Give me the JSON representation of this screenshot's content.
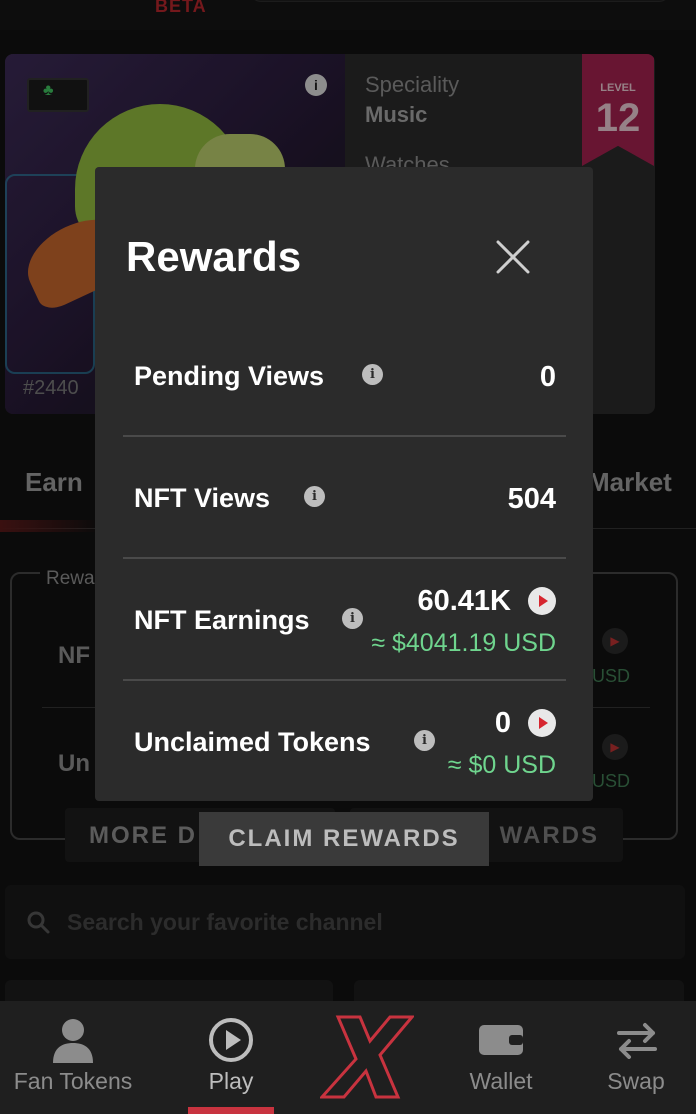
{
  "app": {
    "beta_badge": "BETA"
  },
  "nft_card": {
    "id": "#2440",
    "speciality_label": "Speciality",
    "speciality_value": "Music",
    "watches_label": "Watches",
    "level_label": "LEVEL",
    "level_value": "12"
  },
  "tabs": {
    "earn": "Earn",
    "market": "Market"
  },
  "rewards_box": {
    "legend": "Rewa",
    "row1_partial": "NF",
    "row2_partial": "Un",
    "usd_partial_1": "USD",
    "usd_partial_2": "USD"
  },
  "buttons": {
    "more_details_partial": "MORE D",
    "claim_rewards_bg_partial": "WARDS",
    "claim_rewards": "CLAIM REWARDS"
  },
  "search": {
    "placeholder": "Search your favorite channel"
  },
  "modal": {
    "title": "Rewards",
    "rows": [
      {
        "label": "Pending Views",
        "value": "0"
      },
      {
        "label": "NFT Views",
        "value": "504"
      },
      {
        "label": "NFT Earnings",
        "value": "60.41K",
        "usd": "≈ $4041.19 USD"
      },
      {
        "label": "Unclaimed Tokens",
        "value": "0",
        "usd": "≈ $0 USD"
      }
    ]
  },
  "bottom_nav": {
    "items": [
      {
        "label": "Fan Tokens",
        "icon": "user-icon"
      },
      {
        "label": "Play",
        "icon": "play-icon",
        "active": true
      },
      {
        "label": "",
        "icon": "x-logo-icon"
      },
      {
        "label": "Wallet",
        "icon": "wallet-icon"
      },
      {
        "label": "Swap",
        "icon": "swap-arrows-icon"
      }
    ]
  },
  "colors": {
    "accent_red": "#c8333f",
    "usd_green": "#6fd58e",
    "level_ribbon": "#a0214d",
    "modal_bg": "#2b2b2b"
  }
}
